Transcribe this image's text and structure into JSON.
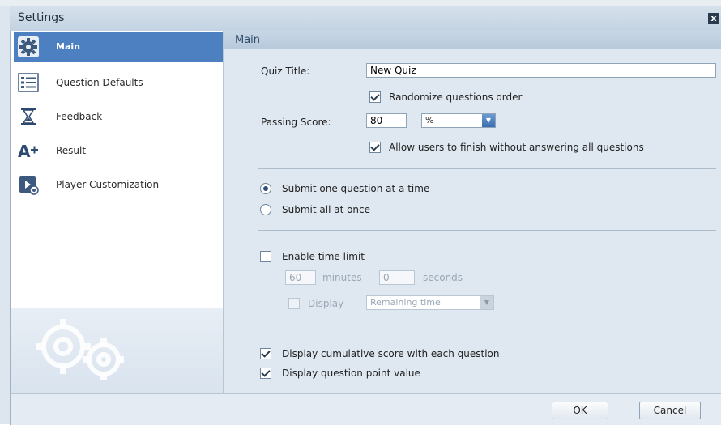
{
  "window": {
    "title": "Settings",
    "close_glyph": "x"
  },
  "sidebar": {
    "items": [
      {
        "label": "Main",
        "icon": "gear-icon",
        "active": true
      },
      {
        "label": "Question Defaults",
        "icon": "list-icon"
      },
      {
        "label": "Feedback",
        "icon": "hourglass-icon"
      },
      {
        "label": "Result",
        "icon": "a-plus-icon"
      },
      {
        "label": "Player Customization",
        "icon": "player-customize-icon"
      }
    ]
  },
  "main": {
    "section_title": "Main",
    "quiz_title": {
      "label": "Quiz Title:",
      "value": "New Quiz"
    },
    "randomize": {
      "label": "Randomize questions order",
      "checked": true
    },
    "passing_score": {
      "label": "Passing Score:",
      "value": "80",
      "unit": "%"
    },
    "allow_finish": {
      "label": "Allow users to finish without answering all questions",
      "checked": true
    },
    "submit_mode": {
      "options": [
        {
          "label": "Submit one question at a time",
          "selected": true
        },
        {
          "label": "Submit all at once",
          "selected": false
        }
      ]
    },
    "time_limit": {
      "enable_label": "Enable time limit",
      "enabled": false,
      "minutes_value": "60",
      "minutes_label": "minutes",
      "seconds_value": "0",
      "seconds_label": "seconds",
      "display_label": "Display",
      "display_value": "Remaining time"
    },
    "cumulative_score": {
      "label": "Display cumulative score with each question",
      "checked": true
    },
    "point_value": {
      "label": "Display question point value",
      "checked": true
    }
  },
  "footer": {
    "ok_label": "OK",
    "cancel_label": "Cancel"
  },
  "colors": {
    "accent": "#4d80c0",
    "panel": "#dfe7f0",
    "header": "#c3d3e3"
  }
}
